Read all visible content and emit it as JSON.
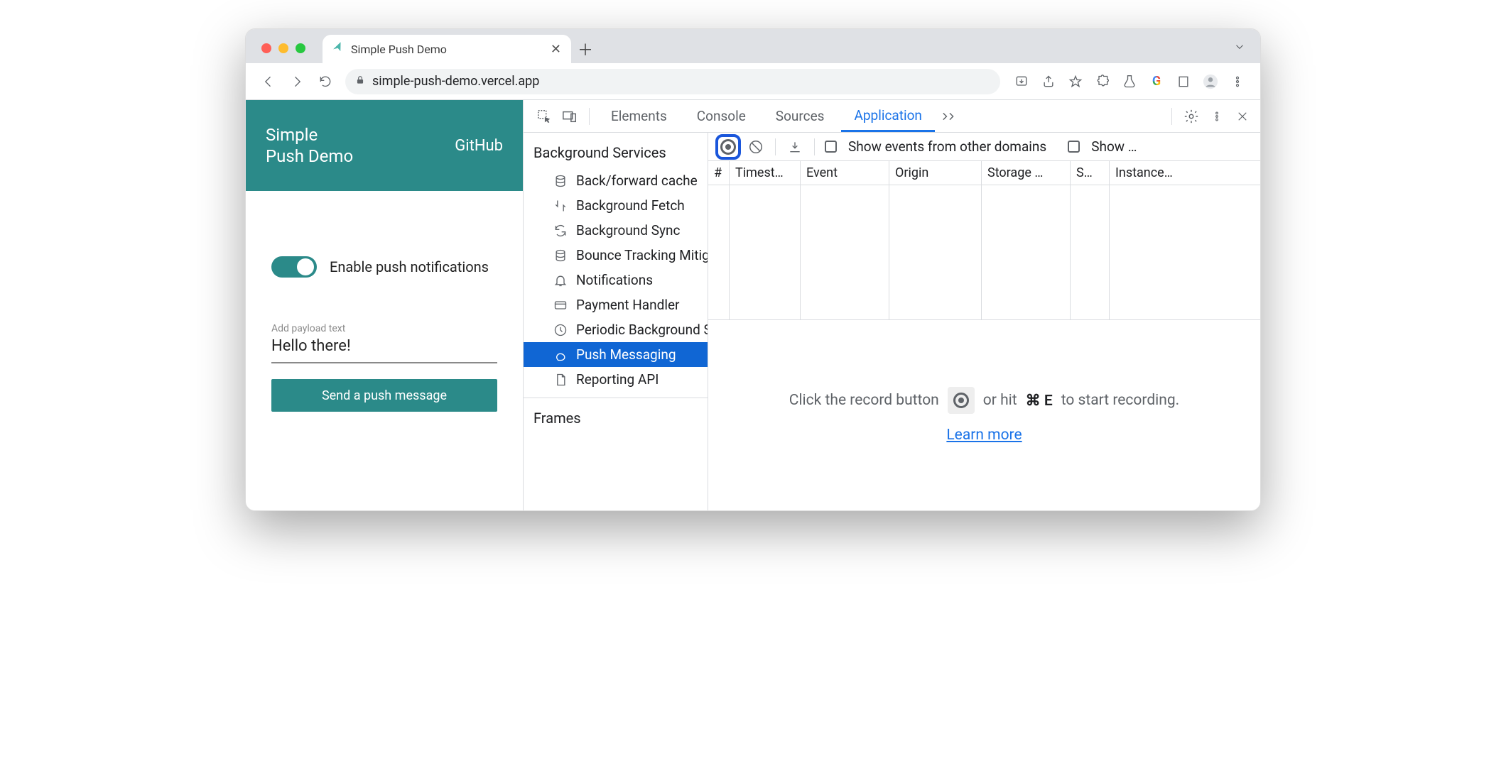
{
  "browser": {
    "tab_title": "Simple Push Demo",
    "url": "simple-push-demo.vercel.app"
  },
  "page": {
    "title_line1": "Simple",
    "title_line2": "Push Demo",
    "github_link": "GitHub",
    "enable_label": "Enable push notifications",
    "payload_label": "Add payload text",
    "payload_value": "Hello there!",
    "send_button": "Send a push message"
  },
  "devtools": {
    "tabs": [
      "Elements",
      "Console",
      "Sources",
      "Application"
    ],
    "active_tab": "Application",
    "sidebar": {
      "section": "Background Services",
      "items": [
        "Back/forward cache",
        "Background Fetch",
        "Background Sync",
        "Bounce Tracking Mitigations",
        "Notifications",
        "Payment Handler",
        "Periodic Background Sync",
        "Push Messaging",
        "Reporting API"
      ],
      "selected": "Push Messaging",
      "frames": "Frames"
    },
    "toolbar": {
      "check1_label": "Show events from other domains",
      "check2_label": "Show …"
    },
    "columns": [
      "#",
      "Timest…",
      "Event",
      "Origin",
      "Storage …",
      "S…",
      "Instance…"
    ],
    "placeholder_before": "Click the record button",
    "placeholder_after_a": "or hit",
    "placeholder_shortcut": "⌘ E",
    "placeholder_after_b": "to start recording.",
    "learn_more": "Learn more"
  }
}
